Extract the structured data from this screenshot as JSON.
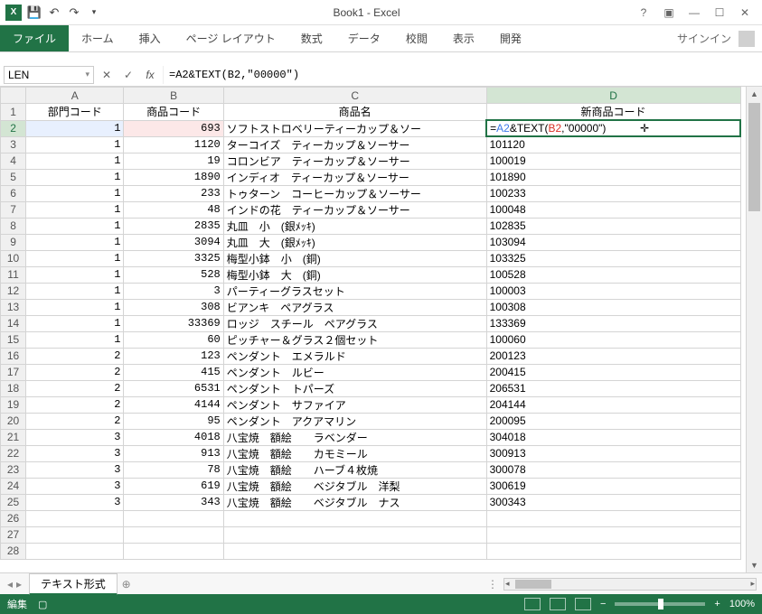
{
  "window": {
    "title": "Book1 - Excel"
  },
  "ribbon": {
    "file": "ファイル",
    "tabs": [
      "ホーム",
      "挿入",
      "ページ レイアウト",
      "数式",
      "データ",
      "校閲",
      "表示",
      "開発"
    ],
    "signin": "サインイン"
  },
  "formula_bar": {
    "name_box": "LEN",
    "formula": "=A2&TEXT(B2,\"00000\")",
    "d2_parts": {
      "prefix": "=",
      "refA": "A2",
      "mid": "&TEXT(",
      "refB": "B2",
      "suffix": ",\"00000\")"
    }
  },
  "columns": [
    "A",
    "B",
    "C",
    "D"
  ],
  "headers": {
    "A": "部門コード",
    "B": "商品コード",
    "C": "商品名",
    "D": "新商品コード"
  },
  "rows": [
    {
      "n": 2,
      "a": "1",
      "b": "693",
      "c": "ソフトストロベリーティーカップ＆ソー",
      "d": "__FORMULA__"
    },
    {
      "n": 3,
      "a": "1",
      "b": "1120",
      "c": "ターコイズ　ティーカップ＆ソーサー",
      "d": "101120"
    },
    {
      "n": 4,
      "a": "1",
      "b": "19",
      "c": "コロンビア　ティーカップ＆ソーサー",
      "d": "100019"
    },
    {
      "n": 5,
      "a": "1",
      "b": "1890",
      "c": "インディオ　ティーカップ＆ソーサー",
      "d": "101890"
    },
    {
      "n": 6,
      "a": "1",
      "b": "233",
      "c": "トゥターン　コーヒーカップ＆ソーサー",
      "d": "100233"
    },
    {
      "n": 7,
      "a": "1",
      "b": "48",
      "c": "インドの花　ティーカップ＆ソーサー",
      "d": "100048"
    },
    {
      "n": 8,
      "a": "1",
      "b": "2835",
      "c": "丸皿　小　(銀ﾒｯｷ)",
      "d": "102835"
    },
    {
      "n": 9,
      "a": "1",
      "b": "3094",
      "c": "丸皿　大　(銀ﾒｯｷ)",
      "d": "103094"
    },
    {
      "n": 10,
      "a": "1",
      "b": "3325",
      "c": "梅型小鉢　小　(銅)",
      "d": "103325"
    },
    {
      "n": 11,
      "a": "1",
      "b": "528",
      "c": "梅型小鉢　大　(銅)",
      "d": "100528"
    },
    {
      "n": 12,
      "a": "1",
      "b": "3",
      "c": "パーティーグラスセット",
      "d": "100003"
    },
    {
      "n": 13,
      "a": "1",
      "b": "308",
      "c": "ビアンキ　ペアグラス",
      "d": "100308"
    },
    {
      "n": 14,
      "a": "1",
      "b": "33369",
      "c": "ロッジ　スチール　ペアグラス",
      "d": "133369"
    },
    {
      "n": 15,
      "a": "1",
      "b": "60",
      "c": "ピッチャー＆グラス２個セット",
      "d": "100060"
    },
    {
      "n": 16,
      "a": "2",
      "b": "123",
      "c": "ペンダント　エメラルド",
      "d": "200123"
    },
    {
      "n": 17,
      "a": "2",
      "b": "415",
      "c": "ペンダント　ルビー",
      "d": "200415"
    },
    {
      "n": 18,
      "a": "2",
      "b": "6531",
      "c": "ペンダント　トパーズ",
      "d": "206531"
    },
    {
      "n": 19,
      "a": "2",
      "b": "4144",
      "c": "ペンダント　サファイア",
      "d": "204144"
    },
    {
      "n": 20,
      "a": "2",
      "b": "95",
      "c": "ペンダント　アクアマリン",
      "d": "200095"
    },
    {
      "n": 21,
      "a": "3",
      "b": "4018",
      "c": "八宝焼　額絵　　ラベンダー",
      "d": "304018"
    },
    {
      "n": 22,
      "a": "3",
      "b": "913",
      "c": "八宝焼　額絵　　カモミール",
      "d": "300913"
    },
    {
      "n": 23,
      "a": "3",
      "b": "78",
      "c": "八宝焼　額絵　　ハーブ４枚焼",
      "d": "300078"
    },
    {
      "n": 24,
      "a": "3",
      "b": "619",
      "c": "八宝焼　額絵　　ベジタブル　洋梨",
      "d": "300619"
    },
    {
      "n": 25,
      "a": "3",
      "b": "343",
      "c": "八宝焼　額絵　　ベジタブル　ナス",
      "d": "300343"
    },
    {
      "n": 26,
      "a": "",
      "b": "",
      "c": "",
      "d": ""
    },
    {
      "n": 27,
      "a": "",
      "b": "",
      "c": "",
      "d": ""
    },
    {
      "n": 28,
      "a": "",
      "b": "",
      "c": "",
      "d": ""
    }
  ],
  "sheet": {
    "active": "テキスト形式"
  },
  "status": {
    "mode": "編集",
    "zoom": "100%"
  }
}
